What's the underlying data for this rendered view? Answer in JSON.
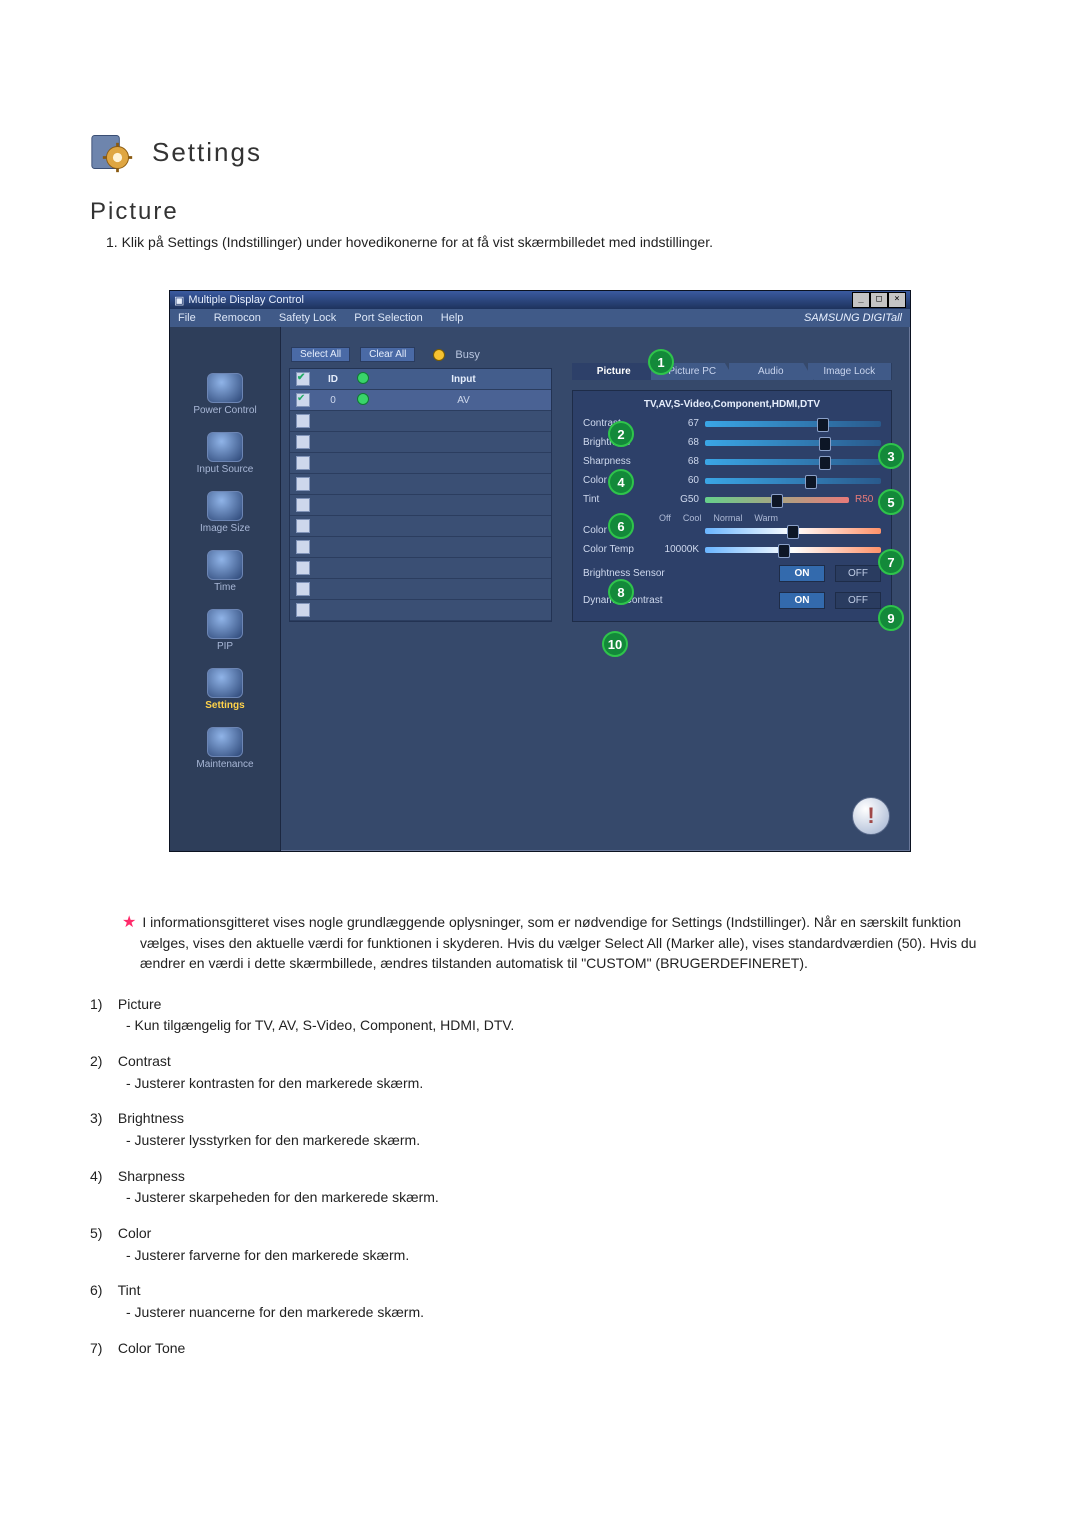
{
  "header": {
    "settings_title": "Settings",
    "page_title": "Picture",
    "intro_number": "1.",
    "intro_text": "Klik på Settings (Indstillinger) under hovedikonerne for at få vist skærmbilledet med indstillinger."
  },
  "app": {
    "window_title": "Multiple Display Control",
    "menus": [
      "File",
      "Remocon",
      "Safety Lock",
      "Port Selection",
      "Help"
    ],
    "brand": "SAMSUNG DIGITall",
    "sidebar": [
      {
        "label": "Power Control"
      },
      {
        "label": "Input Source"
      },
      {
        "label": "Image Size"
      },
      {
        "label": "Time"
      },
      {
        "label": "PIP"
      },
      {
        "label": "Settings",
        "active": true
      },
      {
        "label": "Maintenance"
      }
    ],
    "buttons": {
      "select_all": "Select All",
      "clear_all": "Clear All",
      "busy": "Busy"
    },
    "grid": {
      "headers": {
        "id": "ID",
        "input": "Input"
      },
      "rows": [
        {
          "checked": true,
          "id": "0",
          "status": "green",
          "input": "AV"
        }
      ],
      "empty_rows": 10
    },
    "tabs": [
      "Picture",
      "Picture PC",
      "Audio",
      "Image Lock"
    ],
    "active_tab": 0,
    "source_line": "TV,AV,S-Video,Component,HDMI,DTV",
    "sliders": {
      "contrast": {
        "label": "Contrast",
        "value": "67",
        "pct": 67
      },
      "brightness": {
        "label": "Brightness",
        "value": "68",
        "pct": 68
      },
      "sharpness": {
        "label": "Sharpness",
        "value": "68",
        "pct": 68
      },
      "color": {
        "label": "Color",
        "value": "60",
        "pct": 60
      },
      "tint": {
        "label": "Tint",
        "value": "G50",
        "right": "R50",
        "pct": 50
      },
      "color_tone": {
        "label": "Color Tone",
        "pct": 50
      },
      "color_temp": {
        "label": "Color Temp",
        "value": "10000K",
        "pct": 45
      }
    },
    "color_tone_options": [
      "Off",
      "Cool",
      "Normal",
      "Warm"
    ],
    "brightness_sensor": {
      "label": "Brightness Sensor",
      "on": "ON",
      "off": "OFF"
    },
    "dynamic_contrast": {
      "label": "Dynamic Contrast",
      "on": "ON",
      "off": "OFF"
    }
  },
  "callouts": {
    "c1": "1",
    "c2": "2",
    "c3": "3",
    "c4": "4",
    "c5": "5",
    "c6": "6",
    "c7": "7",
    "c8": "8",
    "c9": "9",
    "c10": "10"
  },
  "info_paragraph": "I informationsgitteret vises nogle grundlæggende oplysninger, som er nødvendige for Settings (Indstillinger). Når en særskilt funktion vælges, vises den aktuelle værdi for funktionen i skyderen. Hvis du vælger Select All (Marker alle), vises standardværdien (50). Hvis du ændrer en værdi i dette skærmbillede, ændres tilstanden automatisk til \"CUSTOM\" (BRUGERDEFINERET).",
  "definitions": [
    {
      "num": "1)",
      "name": "Picture",
      "desc": "- Kun tilgængelig for TV, AV, S-Video, Component, HDMI, DTV."
    },
    {
      "num": "2)",
      "name": "Contrast",
      "desc": "- Justerer kontrasten for den markerede skærm."
    },
    {
      "num": "3)",
      "name": "Brightness",
      "desc": "- Justerer lysstyrken for den markerede skærm."
    },
    {
      "num": "4)",
      "name": "Sharpness",
      "desc": "- Justerer skarpeheden for den markerede skærm."
    },
    {
      "num": "5)",
      "name": "Color",
      "desc": "- Justerer farverne for den markerede skærm."
    },
    {
      "num": "6)",
      "name": "Tint",
      "desc": "- Justerer nuancerne for den markerede skærm."
    },
    {
      "num": "7)",
      "name": "Color Tone",
      "desc": ""
    }
  ]
}
